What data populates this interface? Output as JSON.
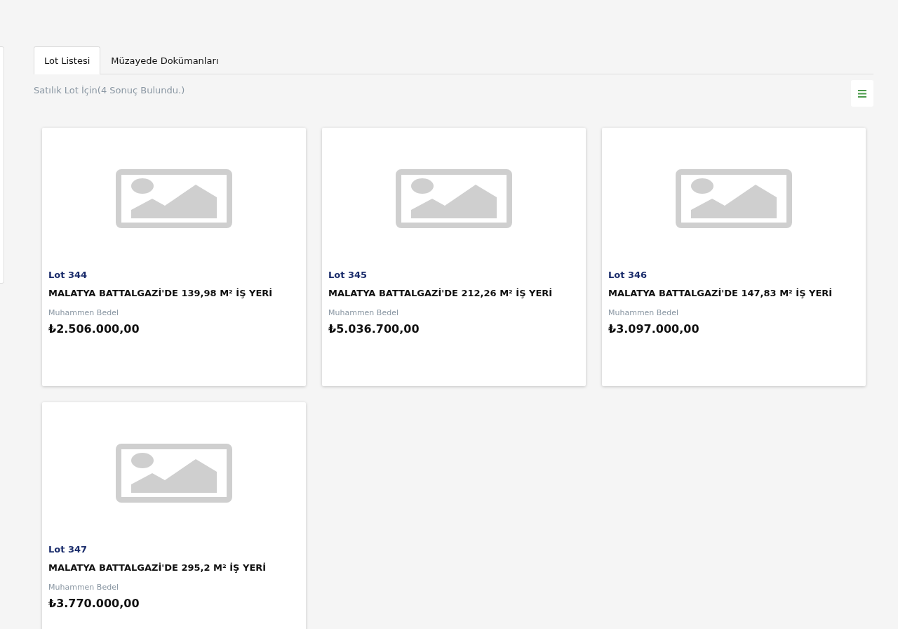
{
  "tabs": [
    {
      "label": "Lot Listesi",
      "selected": true
    },
    {
      "label": "Müzayede Dokümanları",
      "selected": false
    }
  ],
  "result_summary": "Satılık Lot İçin(4 Sonuç Bulundu.)",
  "lots": [
    {
      "lot": "Lot 344",
      "title": "MALATYA BATTALGAZİ'DE 139,98 M² İŞ YERİ",
      "price_label": "Muhammen Bedel",
      "price": "₺2.506.000,00"
    },
    {
      "lot": "Lot 345",
      "title": "MALATYA BATTALGAZİ'DE 212,26 M² İŞ YERİ",
      "price_label": "Muhammen Bedel",
      "price": "₺5.036.700,00"
    },
    {
      "lot": "Lot 346",
      "title": "MALATYA BATTALGAZİ'DE 147,83 M² İŞ YERİ",
      "price_label": "Muhammen Bedel",
      "price": "₺3.097.000,00"
    },
    {
      "lot": "Lot 347",
      "title": "MALATYA BATTALGAZİ'DE 295,2 M² İŞ YERİ",
      "price_label": "Muhammen Bedel",
      "price": "₺3.770.000,00"
    }
  ]
}
